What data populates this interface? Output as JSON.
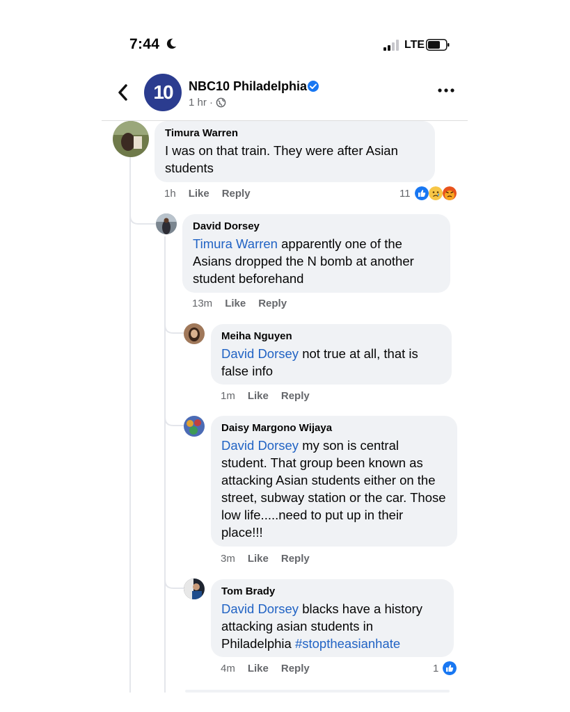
{
  "status_bar": {
    "time": "7:44",
    "network": "LTE"
  },
  "header": {
    "page_name": "NBC10 Philadelphia",
    "logo_text": "10",
    "post_time": "1 hr ·"
  },
  "comments": [
    {
      "author": "Timura Warren",
      "text": "I was on that train. They were after Asian students",
      "time": "1h",
      "like": "Like",
      "reply": "Reply",
      "reaction_count": "11"
    },
    {
      "author": "David Dorsey",
      "mention": "Timura Warren",
      "text": "apparently one of the Asians dropped the N bomb at another student beforehand",
      "time": "13m",
      "like": "Like",
      "reply": "Reply"
    },
    {
      "author": "Meiha Nguyen",
      "mention": "David Dorsey",
      "text": "not true at all, that is false info",
      "time": "1m",
      "like": "Like",
      "reply": "Reply"
    },
    {
      "author": "Daisy Margono Wijaya",
      "mention": "David Dorsey",
      "text": "my son is central student. That group been known as attacking Asian students either on the street, subway station or the car. Those low life.....need to put up in their place!!!",
      "time": "3m",
      "like": "Like",
      "reply": "Reply"
    },
    {
      "author": "Tom Brady",
      "mention": "David Dorsey",
      "text": "blacks have a history attacking asian students in Philadelphia",
      "hashtag": "#stoptheasianhate",
      "time": "4m",
      "like": "Like",
      "reply": "Reply",
      "reaction_count": "1"
    }
  ],
  "colors": {
    "link": "#2163c4",
    "like_blue": "#1877f2",
    "bubble": "#f0f2f5",
    "meta": "#65676b"
  }
}
